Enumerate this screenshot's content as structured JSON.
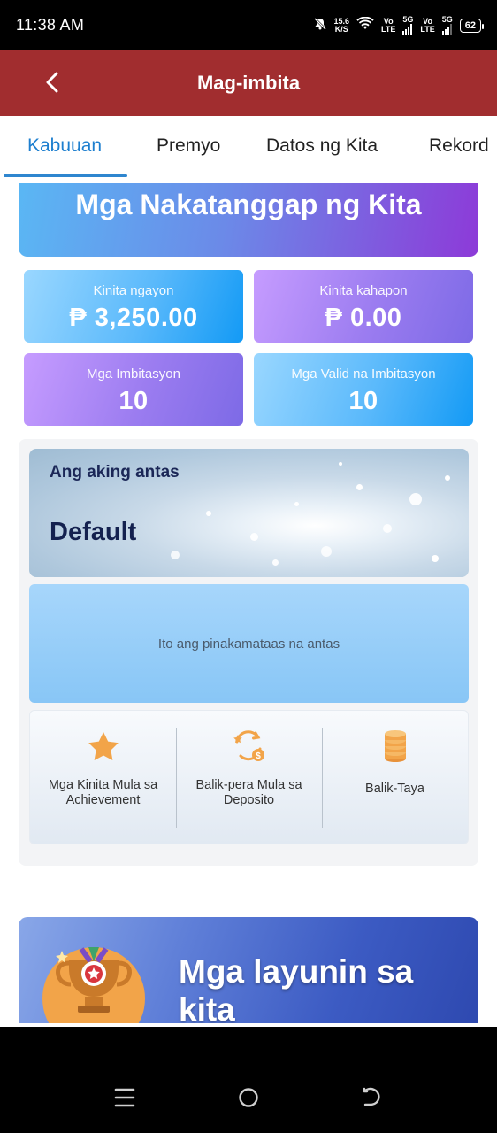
{
  "status_bar": {
    "time": "11:38 AM",
    "net_speed_value": "15.6",
    "net_speed_unit": "K/S",
    "volte1_a": "Vo",
    "volte1_b": "LTE",
    "net1": "5G",
    "volte2_a": "Vo",
    "volte2_b": "LTE",
    "net2": "5G",
    "battery": "62"
  },
  "header": {
    "title": "Mag-imbita",
    "back_icon": "chevron-left-icon"
  },
  "tabs": [
    {
      "label": "Kabuuan",
      "active": true
    },
    {
      "label": "Premyo",
      "active": false
    },
    {
      "label": "Datos ng Kita",
      "active": false
    },
    {
      "label": "Rekord",
      "active": false
    }
  ],
  "banner": {
    "title": "Mga Nakatanggap ng Kita"
  },
  "stats": {
    "today_label": "Kinita ngayon",
    "today_value": "₱ 3,250.00",
    "yesterday_label": "Kinita kahapon",
    "yesterday_value": "₱ 0.00",
    "invites_label": "Mga Imbitasyon",
    "invites_value": "10",
    "valid_label": "Mga Valid na Imbitasyon",
    "valid_value": "10"
  },
  "level": {
    "subtitle": "Ang aking antas",
    "rank": "Default",
    "max_message": "Ito ang pinakamataas na antas"
  },
  "features": [
    {
      "label": "Mga Kinita Mula sa Achievement",
      "icon": "star-icon"
    },
    {
      "label": "Balik-pera Mula sa Deposito",
      "icon": "cashback-icon"
    },
    {
      "label": "Balik-Taya",
      "icon": "coins-icon"
    }
  ],
  "goals": {
    "title": "Mga layunin sa kita",
    "icon": "trophy-icon"
  },
  "colors": {
    "header": "#a12d2f",
    "active_tab": "#1e7fcf",
    "icon_orange": "#f2a449"
  }
}
